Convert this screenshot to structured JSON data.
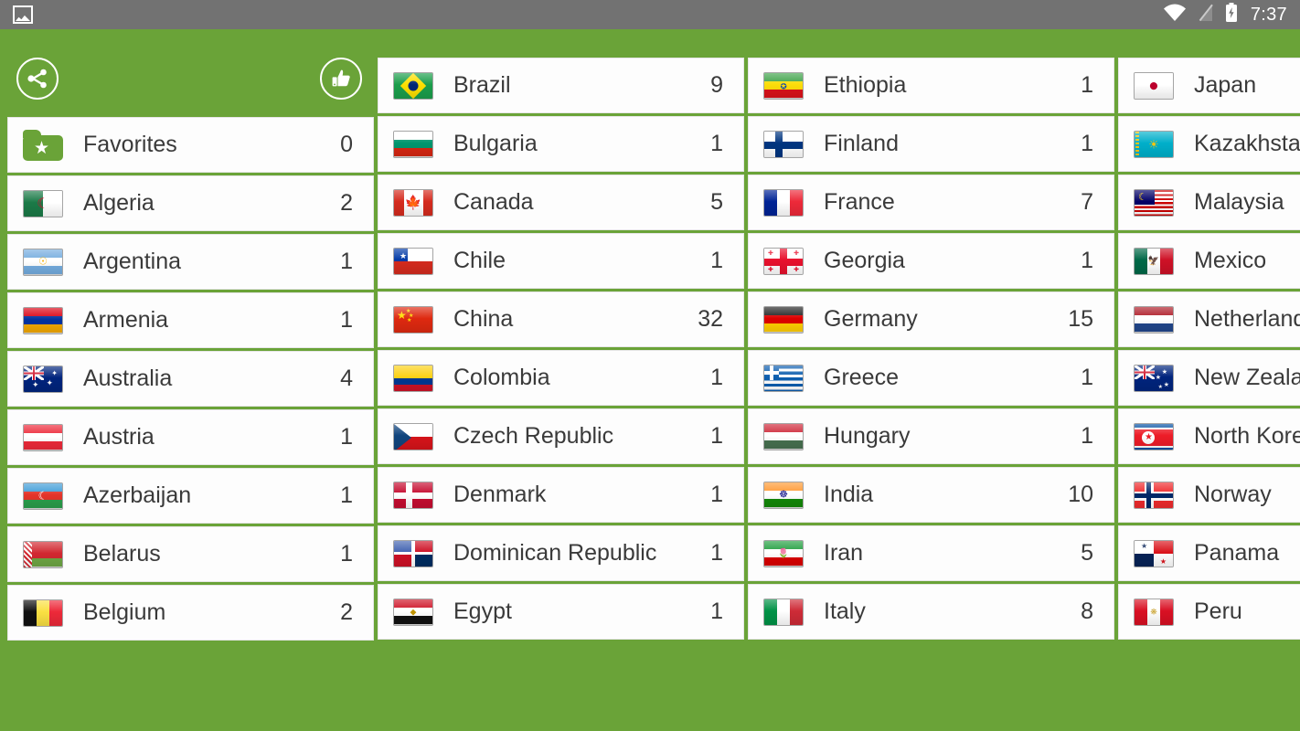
{
  "status_bar": {
    "left_icon": "photo-icon",
    "wifi_icon": "wifi-icon",
    "signal_off_icon": "signal-off-icon",
    "battery_charging_icon": "battery-charging-icon",
    "time": "7:37"
  },
  "theme": {
    "accent_green": "#6aa338",
    "row_bg": "#fdfdfd",
    "text": "#3a3a3a",
    "status_bar_bg": "#727272"
  },
  "toolbar": {
    "share_label": "share-icon",
    "like_label": "thumbs-up-icon"
  },
  "columns": [
    {
      "id": "column-1",
      "rows": [
        {
          "name": "Favorites",
          "count": "0",
          "icon": "favorites-folder-icon"
        },
        {
          "name": "Algeria",
          "count": "2",
          "flag": "dz"
        },
        {
          "name": "Argentina",
          "count": "1",
          "flag": "ar"
        },
        {
          "name": "Armenia",
          "count": "1",
          "flag": "am"
        },
        {
          "name": "Australia",
          "count": "4",
          "flag": "au"
        },
        {
          "name": "Austria",
          "count": "1",
          "flag": "at"
        },
        {
          "name": "Azerbaijan",
          "count": "1",
          "flag": "az"
        },
        {
          "name": "Belarus",
          "count": "1",
          "flag": "by"
        },
        {
          "name": "Belgium",
          "count": "2",
          "flag": "be"
        }
      ]
    },
    {
      "id": "column-2",
      "rows": [
        {
          "name": "Brazil",
          "count": "9",
          "flag": "br"
        },
        {
          "name": "Bulgaria",
          "count": "1",
          "flag": "bg"
        },
        {
          "name": "Canada",
          "count": "5",
          "flag": "ca"
        },
        {
          "name": "Chile",
          "count": "1",
          "flag": "cl"
        },
        {
          "name": "China",
          "count": "32",
          "flag": "cn"
        },
        {
          "name": "Colombia",
          "count": "1",
          "flag": "co"
        },
        {
          "name": "Czech Republic",
          "count": "1",
          "flag": "cz"
        },
        {
          "name": "Denmark",
          "count": "1",
          "flag": "dk"
        },
        {
          "name": "Dominican Republic",
          "count": "1",
          "flag": "do"
        },
        {
          "name": "Egypt",
          "count": "1",
          "flag": "eg"
        }
      ]
    },
    {
      "id": "column-3",
      "rows": [
        {
          "name": "Ethiopia",
          "count": "1",
          "flag": "et"
        },
        {
          "name": "Finland",
          "count": "1",
          "flag": "fi"
        },
        {
          "name": "France",
          "count": "7",
          "flag": "fr"
        },
        {
          "name": "Georgia",
          "count": "1",
          "flag": "ge"
        },
        {
          "name": "Germany",
          "count": "15",
          "flag": "de"
        },
        {
          "name": "Greece",
          "count": "1",
          "flag": "gr"
        },
        {
          "name": "Hungary",
          "count": "1",
          "flag": "hu"
        },
        {
          "name": "India",
          "count": "10",
          "flag": "in"
        },
        {
          "name": "Iran",
          "count": "5",
          "flag": "ir"
        },
        {
          "name": "Italy",
          "count": "8",
          "flag": "it"
        }
      ]
    },
    {
      "id": "column-4",
      "clipped": true,
      "rows": [
        {
          "name": "Japan",
          "count": "",
          "flag": "jp"
        },
        {
          "name": "Kazakhstan",
          "count": "",
          "flag": "kz"
        },
        {
          "name": "Malaysia",
          "count": "",
          "flag": "my"
        },
        {
          "name": "Mexico",
          "count": "",
          "flag": "mx"
        },
        {
          "name": "Netherlands",
          "count": "",
          "flag": "nl"
        },
        {
          "name": "New Zealand",
          "count": "",
          "flag": "nz"
        },
        {
          "name": "North Korea",
          "count": "",
          "flag": "kp"
        },
        {
          "name": "Norway",
          "count": "",
          "flag": "no"
        },
        {
          "name": "Panama",
          "count": "",
          "flag": "pa"
        },
        {
          "name": "Peru",
          "count": "",
          "flag": "pe"
        }
      ]
    }
  ]
}
